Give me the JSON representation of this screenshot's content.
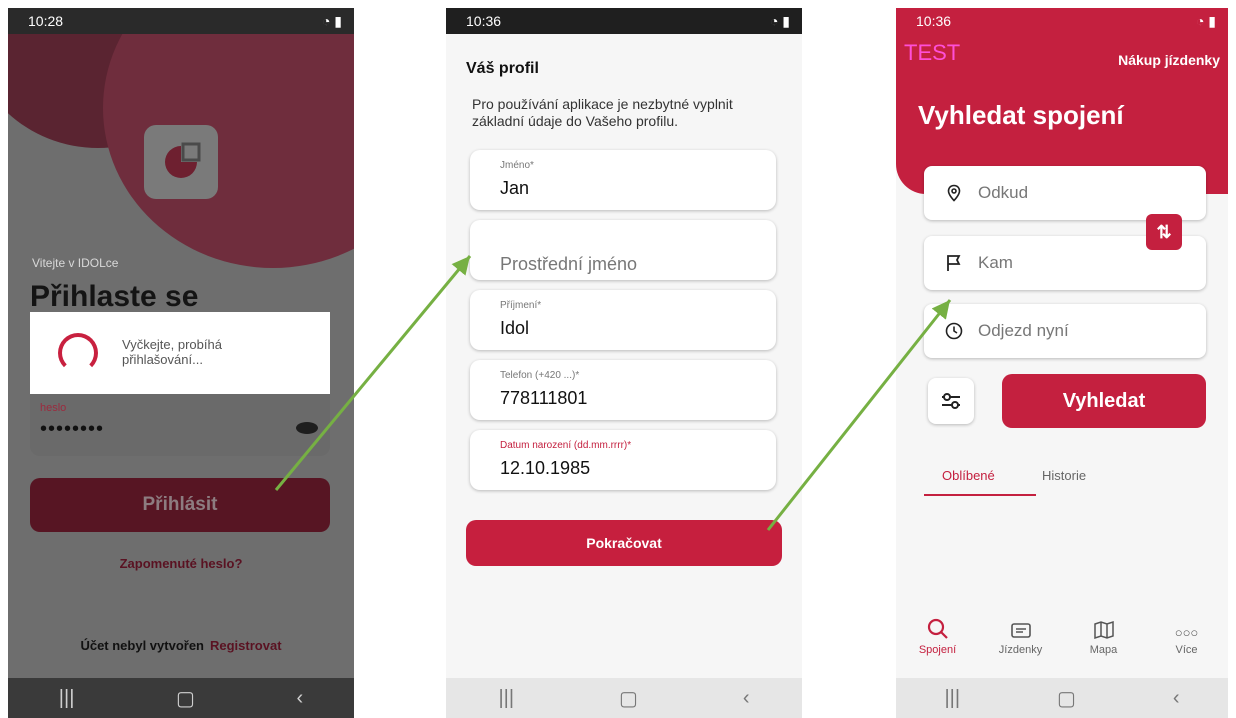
{
  "screen1": {
    "status_time": "10:28",
    "welcome": "Vitejte v IDOLce",
    "title": "Přihlaste se",
    "dialog_text": "Vyčkejte, probíhá přihlašování...",
    "password_label": "heslo",
    "password_value": "••••••••",
    "login_button": "Přihlásit",
    "forgot_link": "Zapomenuté heslo?",
    "no_account": "Účet nebyl vytvořen",
    "register_link": "Registrovat"
  },
  "screen2": {
    "status_time": "10:36",
    "title": "Váš profil",
    "intro": "Pro používání aplikace je nezbytné vyplnit základní údaje do Vašeho profilu.",
    "fields": [
      {
        "label": "Jméno*",
        "value": "Jan"
      },
      {
        "placeholder": "Prostřední jméno"
      },
      {
        "label": "Příjmení*",
        "value": "Idol"
      },
      {
        "label": "Telefon (+420 ...)*",
        "value": "778111801"
      },
      {
        "label": "Datum narození (dd.mm.rrrr)*",
        "value": "12.10.1985"
      }
    ],
    "continue_button": "Pokračovat"
  },
  "screen3": {
    "status_time": "10:36",
    "test_label": "TEST",
    "buy_ticket": "Nákup jízdenky",
    "title": "Vyhledat spojení",
    "from_placeholder": "Odkud",
    "to_placeholder": "Kam",
    "depart_placeholder": "Odjezd nyní",
    "search_button": "Vyhledat",
    "tabs": [
      "Oblíbené",
      "Historie"
    ],
    "bottom_nav": [
      {
        "label": "Spojení",
        "icon": "search-icon"
      },
      {
        "label": "Jízdenky",
        "icon": "ticket-icon"
      },
      {
        "label": "Mapa",
        "icon": "map-icon"
      },
      {
        "label": "Více",
        "icon": "more-icon"
      }
    ]
  },
  "colors": {
    "accent": "#c4203f",
    "arrow": "#76b043"
  }
}
